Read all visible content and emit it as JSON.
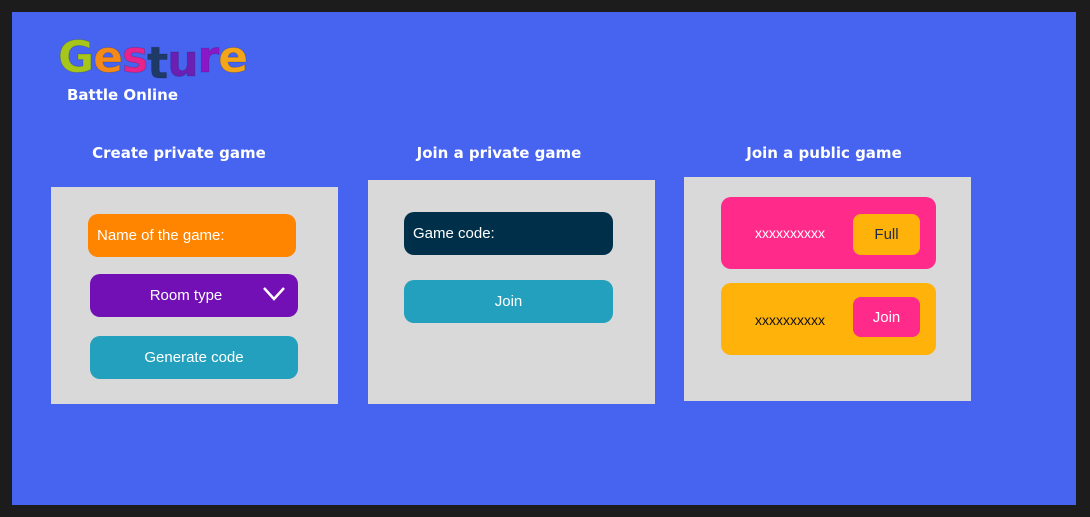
{
  "app": {
    "logo_letters": [
      "G",
      "e",
      "s",
      "t",
      "u",
      "r",
      "e"
    ],
    "logo_colors": [
      "#a7c61a",
      "#f48a18",
      "#e8238c",
      "#1f3a66",
      "#6b1fb3",
      "#8a18c8",
      "#f5a51a"
    ],
    "subtitle": "Battle Online",
    "background_color": "#4764f1"
  },
  "create": {
    "heading": "Create private game",
    "name_placeholder": "Name of the game:",
    "room_type_label": "Room type",
    "generate_label": "Generate code",
    "colors": {
      "name_field": "#ff8400",
      "room_type": "#720fb5",
      "generate": "#22a0bd"
    }
  },
  "join_private": {
    "heading": "Join a private game",
    "code_placeholder": "Game code:",
    "join_label": "Join",
    "colors": {
      "code_field": "#003049",
      "join": "#22a0bd"
    }
  },
  "join_public": {
    "heading": "Join a public game",
    "games": [
      {
        "name": "xxxxxxxxxx",
        "status": "Full",
        "row_color": "#ff2a8a",
        "badge_color": "#ffb20a"
      },
      {
        "name": "xxxxxxxxxx",
        "status": "Join",
        "row_color": "#ffb20a",
        "badge_color": "#ff2a8a"
      }
    ]
  }
}
